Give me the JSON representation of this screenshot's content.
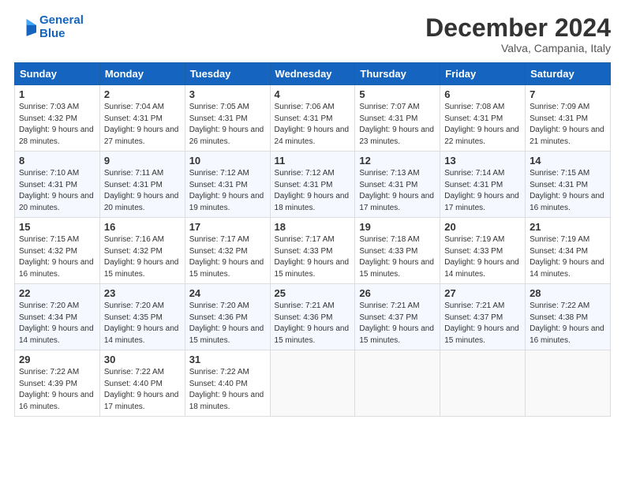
{
  "logo": {
    "line1": "General",
    "line2": "Blue"
  },
  "title": "December 2024",
  "location": "Valva, Campania, Italy",
  "days_of_week": [
    "Sunday",
    "Monday",
    "Tuesday",
    "Wednesday",
    "Thursday",
    "Friday",
    "Saturday"
  ],
  "weeks": [
    [
      {
        "day": "1",
        "sunrise": "7:03 AM",
        "sunset": "4:32 PM",
        "daylight": "9 hours and 28 minutes."
      },
      {
        "day": "2",
        "sunrise": "7:04 AM",
        "sunset": "4:31 PM",
        "daylight": "9 hours and 27 minutes."
      },
      {
        "day": "3",
        "sunrise": "7:05 AM",
        "sunset": "4:31 PM",
        "daylight": "9 hours and 26 minutes."
      },
      {
        "day": "4",
        "sunrise": "7:06 AM",
        "sunset": "4:31 PM",
        "daylight": "9 hours and 24 minutes."
      },
      {
        "day": "5",
        "sunrise": "7:07 AM",
        "sunset": "4:31 PM",
        "daylight": "9 hours and 23 minutes."
      },
      {
        "day": "6",
        "sunrise": "7:08 AM",
        "sunset": "4:31 PM",
        "daylight": "9 hours and 22 minutes."
      },
      {
        "day": "7",
        "sunrise": "7:09 AM",
        "sunset": "4:31 PM",
        "daylight": "9 hours and 21 minutes."
      }
    ],
    [
      {
        "day": "8",
        "sunrise": "7:10 AM",
        "sunset": "4:31 PM",
        "daylight": "9 hours and 20 minutes."
      },
      {
        "day": "9",
        "sunrise": "7:11 AM",
        "sunset": "4:31 PM",
        "daylight": "9 hours and 20 minutes."
      },
      {
        "day": "10",
        "sunrise": "7:12 AM",
        "sunset": "4:31 PM",
        "daylight": "9 hours and 19 minutes."
      },
      {
        "day": "11",
        "sunrise": "7:12 AM",
        "sunset": "4:31 PM",
        "daylight": "9 hours and 18 minutes."
      },
      {
        "day": "12",
        "sunrise": "7:13 AM",
        "sunset": "4:31 PM",
        "daylight": "9 hours and 17 minutes."
      },
      {
        "day": "13",
        "sunrise": "7:14 AM",
        "sunset": "4:31 PM",
        "daylight": "9 hours and 17 minutes."
      },
      {
        "day": "14",
        "sunrise": "7:15 AM",
        "sunset": "4:31 PM",
        "daylight": "9 hours and 16 minutes."
      }
    ],
    [
      {
        "day": "15",
        "sunrise": "7:15 AM",
        "sunset": "4:32 PM",
        "daylight": "9 hours and 16 minutes."
      },
      {
        "day": "16",
        "sunrise": "7:16 AM",
        "sunset": "4:32 PM",
        "daylight": "9 hours and 15 minutes."
      },
      {
        "day": "17",
        "sunrise": "7:17 AM",
        "sunset": "4:32 PM",
        "daylight": "9 hours and 15 minutes."
      },
      {
        "day": "18",
        "sunrise": "7:17 AM",
        "sunset": "4:33 PM",
        "daylight": "9 hours and 15 minutes."
      },
      {
        "day": "19",
        "sunrise": "7:18 AM",
        "sunset": "4:33 PM",
        "daylight": "9 hours and 15 minutes."
      },
      {
        "day": "20",
        "sunrise": "7:19 AM",
        "sunset": "4:33 PM",
        "daylight": "9 hours and 14 minutes."
      },
      {
        "day": "21",
        "sunrise": "7:19 AM",
        "sunset": "4:34 PM",
        "daylight": "9 hours and 14 minutes."
      }
    ],
    [
      {
        "day": "22",
        "sunrise": "7:20 AM",
        "sunset": "4:34 PM",
        "daylight": "9 hours and 14 minutes."
      },
      {
        "day": "23",
        "sunrise": "7:20 AM",
        "sunset": "4:35 PM",
        "daylight": "9 hours and 14 minutes."
      },
      {
        "day": "24",
        "sunrise": "7:20 AM",
        "sunset": "4:36 PM",
        "daylight": "9 hours and 15 minutes."
      },
      {
        "day": "25",
        "sunrise": "7:21 AM",
        "sunset": "4:36 PM",
        "daylight": "9 hours and 15 minutes."
      },
      {
        "day": "26",
        "sunrise": "7:21 AM",
        "sunset": "4:37 PM",
        "daylight": "9 hours and 15 minutes."
      },
      {
        "day": "27",
        "sunrise": "7:21 AM",
        "sunset": "4:37 PM",
        "daylight": "9 hours and 15 minutes."
      },
      {
        "day": "28",
        "sunrise": "7:22 AM",
        "sunset": "4:38 PM",
        "daylight": "9 hours and 16 minutes."
      }
    ],
    [
      {
        "day": "29",
        "sunrise": "7:22 AM",
        "sunset": "4:39 PM",
        "daylight": "9 hours and 16 minutes."
      },
      {
        "day": "30",
        "sunrise": "7:22 AM",
        "sunset": "4:40 PM",
        "daylight": "9 hours and 17 minutes."
      },
      {
        "day": "31",
        "sunrise": "7:22 AM",
        "sunset": "4:40 PM",
        "daylight": "9 hours and 18 minutes."
      },
      null,
      null,
      null,
      null
    ]
  ],
  "labels": {
    "sunrise": "Sunrise:",
    "sunset": "Sunset:",
    "daylight": "Daylight:"
  }
}
